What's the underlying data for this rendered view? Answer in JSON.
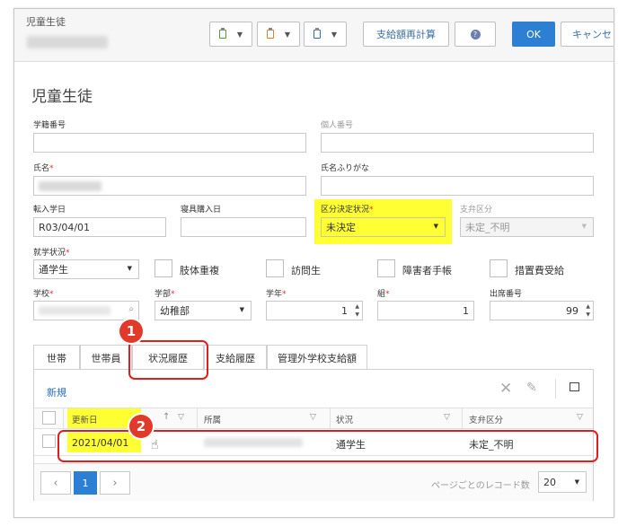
{
  "window": {
    "title": "児童生徒"
  },
  "toolbar": {
    "recalc_label": "支給額再計算",
    "ok_label": "OK",
    "cancel_label": "キャンセ"
  },
  "page": {
    "heading": "児童生徒"
  },
  "form": {
    "student_no_label": "学籍番号",
    "student_no_value": "",
    "personal_no_label": "個人番号",
    "personal_no_value": "",
    "name_label": "氏名",
    "kana_label": "氏名ふりがな",
    "kana_value": "",
    "transfer_date_label": "転入学日",
    "transfer_date_value": "R03/04/01",
    "supplies_date_label": "寝具購入日",
    "supplies_date_value": "",
    "division_status_label": "区分決定状況",
    "division_status_value": "未決定",
    "payment_class_label": "支弁区分",
    "payment_class_value": "未定_不明",
    "attendance_label": "就学状況",
    "attendance_value": "通学生",
    "checkbox_limb": "肢体重複",
    "checkbox_visiting": "訪問生",
    "checkbox_disability_book": "障害者手帳",
    "checkbox_measure": "措置費受給",
    "school_label": "学校",
    "dept_label": "学部",
    "dept_value": "幼稚部",
    "grade_label": "学年",
    "grade_value": "1",
    "class_label": "組",
    "class_value": "1",
    "seat_no_label": "出席番号",
    "seat_no_value": "99"
  },
  "tabs": [
    "世帯",
    "世帯員",
    "状況履歴",
    "支給履歴",
    "管理外学校支給額"
  ],
  "grid": {
    "new_label": "新規",
    "columns": [
      "更新日",
      "所属",
      "状況",
      "支弁区分"
    ],
    "rows": [
      {
        "date": "2021/04/01",
        "affiliation": "",
        "status": "通学生",
        "payment": "未定_不明"
      }
    ]
  },
  "pager": {
    "current_page": "1",
    "page_size_label": "ページごとのレコード数",
    "page_size_value": "20"
  },
  "callouts": [
    "1",
    "2"
  ],
  "colors": {
    "accent": "#2d7fd3",
    "highlight": "#ffff33",
    "callout_red": "#e11d1d",
    "required": "#e03030"
  }
}
